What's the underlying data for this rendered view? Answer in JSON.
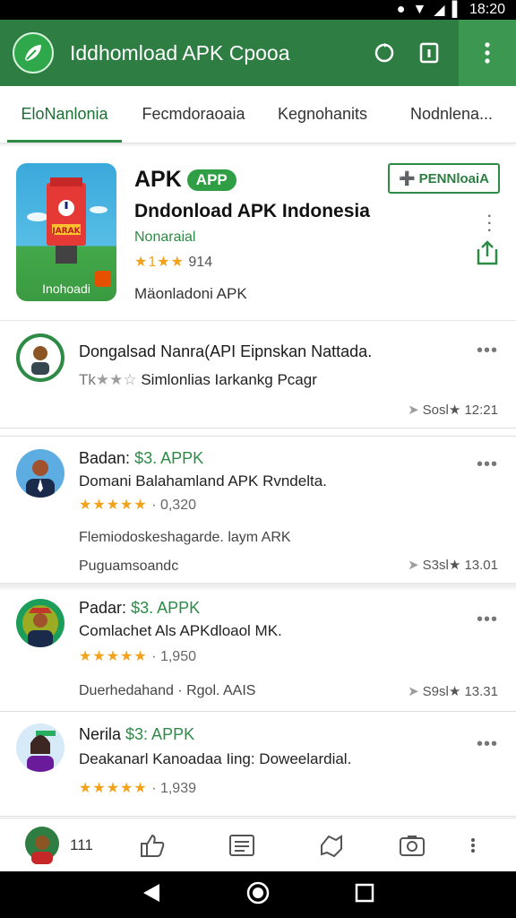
{
  "status_bar": {
    "time": "18:20"
  },
  "app_bar": {
    "title": "Iddhomload APK Cpooa"
  },
  "tabs": [
    {
      "label": "EloNanlonia",
      "active": true
    },
    {
      "label": "Fecmdoraoaia",
      "active": false
    },
    {
      "label": "Kegnohanits",
      "active": false
    },
    {
      "label": "Nodnlena...",
      "active": false
    }
  ],
  "app_card": {
    "name": "APK",
    "badge": "APP",
    "headline": "Dndonload APK Indonesia",
    "developer": "Nonaraial",
    "rating": "914",
    "rating_stars": "★1★★",
    "description": "Mäonladoni APK",
    "icon_label": "Inohoadi",
    "icon_sign": "JARAK",
    "install_label": "PENNloaiA"
  },
  "reviews": [
    {
      "title": "Dongalsad Nanra(API Eipnskan Nattada.",
      "stars_text": "Tk",
      "subtitle": "Simlonlias Iarkankg Pcagr",
      "right_text": "Sosl★ 12:21"
    },
    {
      "name": "Badan:",
      "price": "$3. APPK",
      "line": "Domani Balahamland APK Rvndelta.",
      "stars": "★★★★★",
      "count": "· 0,320",
      "meta1": "Flemiodoskeshagarde. laym ARK",
      "meta2": "Puguamsoandc",
      "right_text": "S3sl★ 13.01"
    },
    {
      "name": "Padar:",
      "price": "$3. APPK",
      "line": "Comlachet Als APKdloaol MK.",
      "stars": "★★★★★",
      "count": "· 1,950",
      "meta1": "Duerhedahand · Rgol. AAIS",
      "right_text": "S9sl★ 13.31"
    },
    {
      "name": "Nerila",
      "price": "$3: APPK",
      "line": "Deakanarl Kanoadaa Iing: Doweelardial.",
      "stars": "★★★★★",
      "count": "· 1,939"
    }
  ],
  "bottom_nav": {
    "first_label": "111"
  },
  "colors": {
    "primary": "#2e7d42",
    "accent": "#2e8b46",
    "star": "#f2a21b"
  }
}
